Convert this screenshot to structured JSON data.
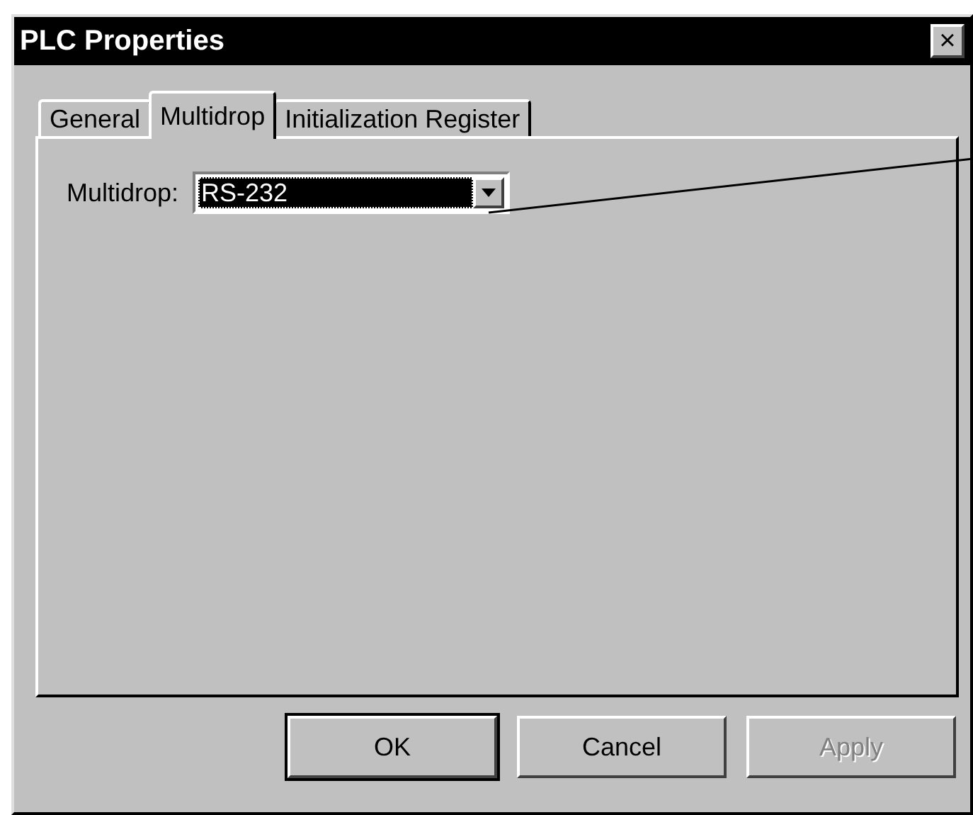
{
  "window": {
    "title": "PLC Properties",
    "close": "×"
  },
  "tabs": [
    {
      "label": "General",
      "selected": false
    },
    {
      "label": "Multidrop",
      "selected": true
    },
    {
      "label": "Initialization Register",
      "selected": false
    }
  ],
  "multidrop": {
    "label": "Multidrop:",
    "value": "RS-232",
    "focused": true
  },
  "buttons": [
    {
      "label": "OK",
      "default": true,
      "disabled": false
    },
    {
      "label": "Cancel",
      "default": false,
      "disabled": false
    },
    {
      "label": "Apply",
      "default": false,
      "disabled": true
    }
  ]
}
